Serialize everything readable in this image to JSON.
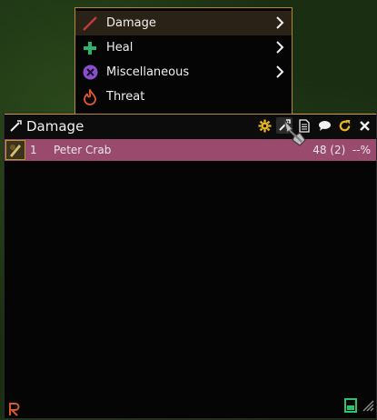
{
  "menu": {
    "items": [
      {
        "label": "Damage",
        "icon": "sword-icon",
        "submenu": true
      },
      {
        "label": "Heal",
        "icon": "plus-icon",
        "submenu": true
      },
      {
        "label": "Miscellaneous",
        "icon": "x-circle-icon",
        "submenu": true
      },
      {
        "label": "Threat",
        "icon": "flame-icon",
        "submenu": false
      }
    ]
  },
  "meter": {
    "title": "Damage",
    "tools": [
      "gear-icon",
      "sword-icon",
      "document-icon",
      "chat-icon",
      "reset-icon",
      "close-icon"
    ],
    "rows": [
      {
        "rank": "1",
        "name": "Peter Crab",
        "value": "48 (2)  --%",
        "color": "#9a4b6d"
      }
    ]
  },
  "colors": {
    "accent": "#caa437",
    "bar": "#9a4b6d",
    "damage": "#c23b3b",
    "heal": "#2db36f",
    "misc": "#8a4fd1",
    "threat": "#e4572e"
  }
}
